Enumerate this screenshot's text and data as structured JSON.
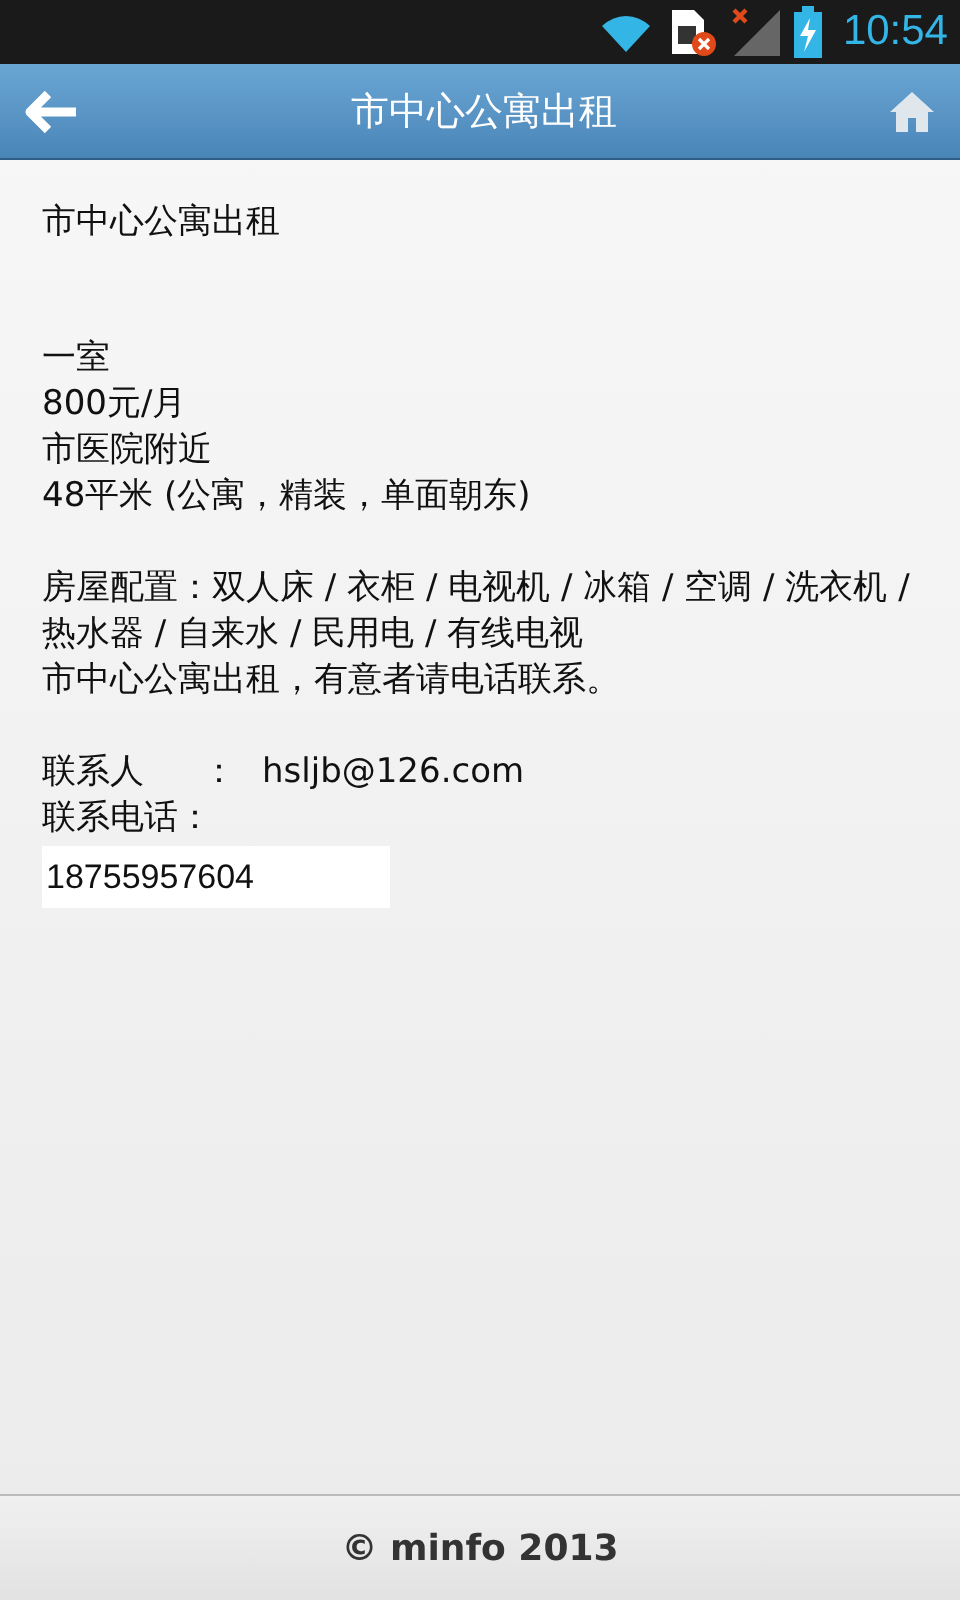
{
  "status_bar": {
    "time": "10:54"
  },
  "header": {
    "title": "市中心公寓出租"
  },
  "content": {
    "heading": "市中心公寓出租",
    "details": [
      "一室",
      "800元/月",
      "市医院附近",
      "48平米 (公寓，精装，单面朝东)"
    ],
    "config": "房屋配置：双人床 / 衣柜 / 电视机 / 冰箱 / 空调 / 洗衣机 / 热水器 / 自来水 / 民用电 / 有线电视",
    "description": "市中心公寓出租，有意者请电话联系。",
    "contact": {
      "label": "联系人",
      "separator": "：",
      "value": "hsljb@126.com"
    },
    "phone": {
      "label": "联系电话：",
      "value": "18755957604"
    }
  },
  "footer": {
    "text": "© minfo 2013"
  }
}
